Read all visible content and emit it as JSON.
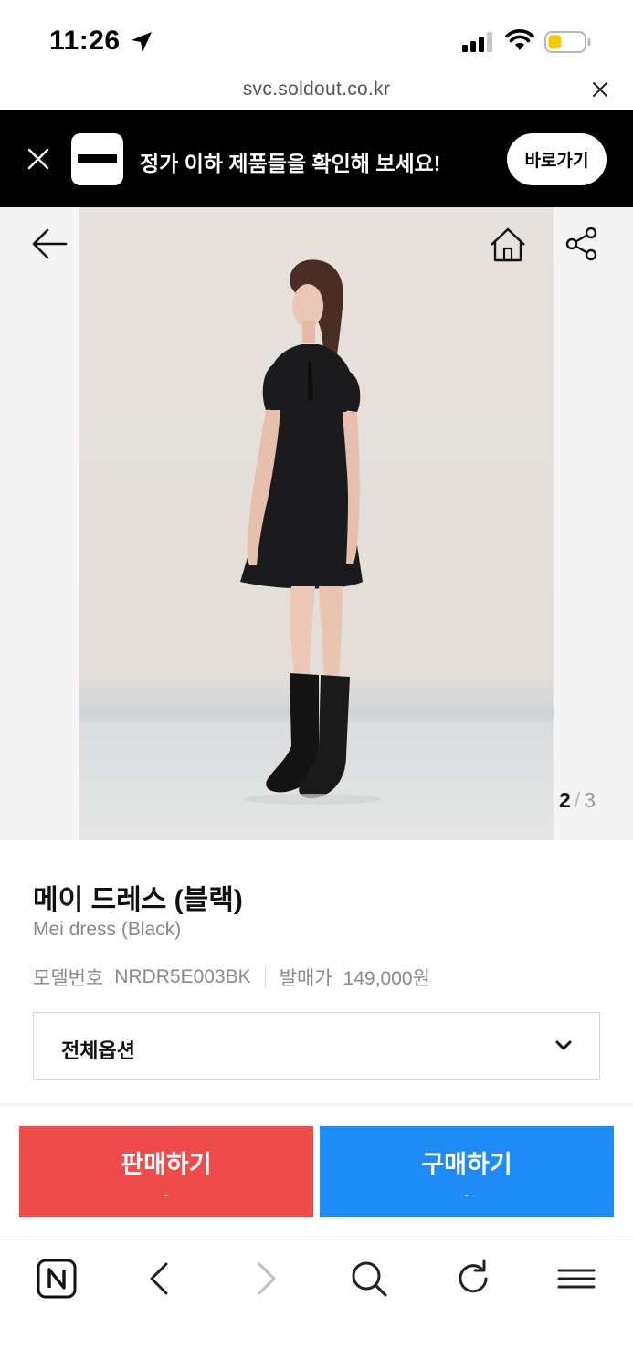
{
  "status_bar": {
    "time": "11:26"
  },
  "browser": {
    "url": "svc.soldout.co.kr"
  },
  "banner": {
    "text": "정가 이하 제품들을 확인해 보세요!",
    "button_label": "바로가기"
  },
  "gallery": {
    "current_page": "2",
    "separator": "/",
    "total_pages": "3"
  },
  "product": {
    "name_ko": "메이 드레스 (블랙)",
    "name_en": "Mei dress (Black)",
    "model_label": "모델번호",
    "model_value": "NRDR5E003BK",
    "release_price_label": "발매가",
    "release_price_value": "149,000원"
  },
  "options": {
    "selected": "전체옵션"
  },
  "actions": {
    "sell_label": "판매하기",
    "sell_price": "-",
    "buy_label": "구매하기",
    "buy_price": "-"
  },
  "colors": {
    "sell": "#ef4b4b",
    "buy": "#1f8cf5",
    "banner_bg": "#000000"
  },
  "icons": {
    "status": [
      "location-arrow-icon",
      "signal-icon",
      "wifi-icon",
      "battery-icon"
    ],
    "header": [
      "back-arrow-icon",
      "home-icon",
      "share-icon"
    ],
    "bottom_nav": [
      "naver-logo-icon",
      "back-icon",
      "forward-icon",
      "search-icon",
      "refresh-icon",
      "menu-icon"
    ]
  }
}
